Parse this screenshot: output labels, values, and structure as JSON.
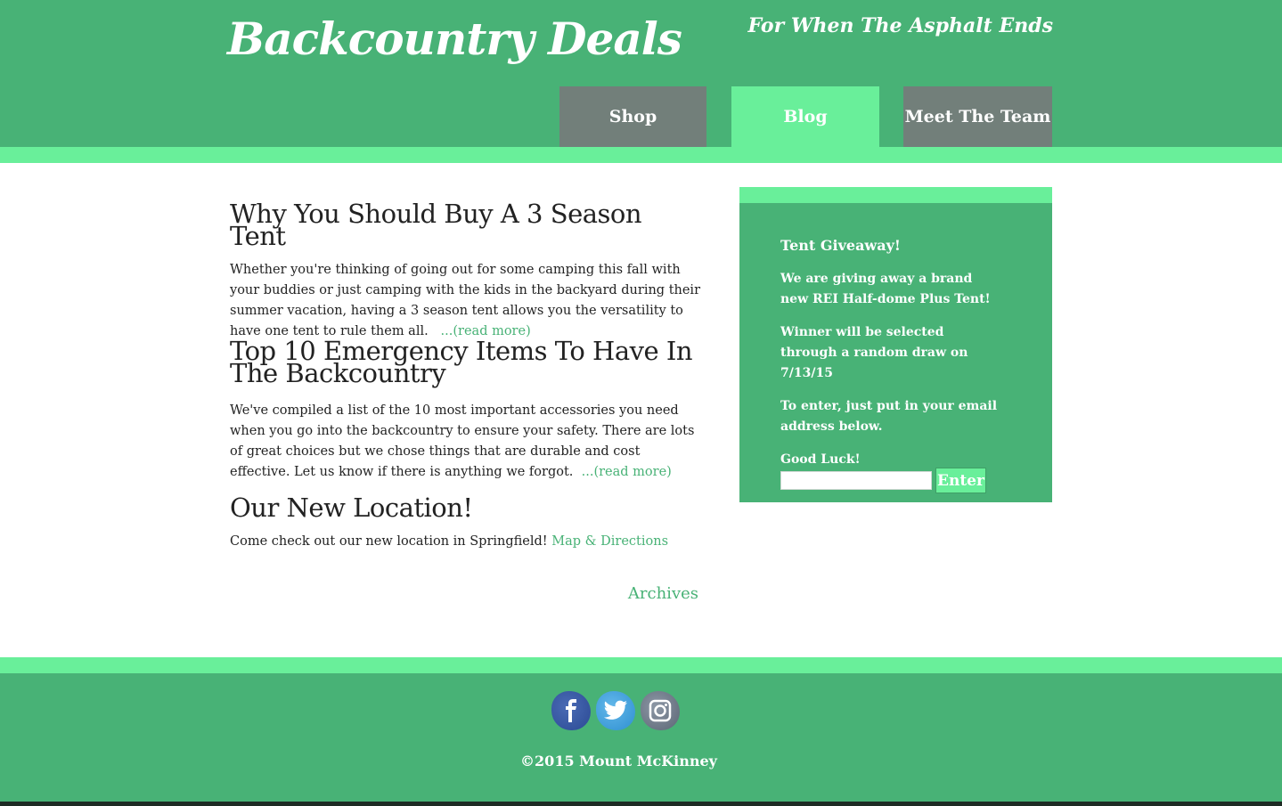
{
  "header": {
    "site_title": "Backcountry Deals",
    "tagline": "For When The Asphalt Ends",
    "nav": [
      {
        "label": "Shop",
        "active": false
      },
      {
        "label": "Blog",
        "active": true
      },
      {
        "label": "Meet The Team",
        "active": false
      }
    ]
  },
  "posts": [
    {
      "title": "Why You Should Buy A 3 Season Tent",
      "body": "Whether you're thinking of going out for some camping this fall with your buddies or just camping with the kids in the backyard during their summer vacation, having a 3 season tent allows you the versatility to have one tent to rule them all.",
      "link": "...(read more)"
    },
    {
      "title": "Top 10 Emergency Items To Have In The Backcountry",
      "body": "We've compiled a list of the 10 most important accessories you need when you go into the backcountry to ensure your safety. There are lots of great choices but we chose things that are durable and cost effective. Let us know if there is anything we forgot.",
      "link": "...(read more)"
    },
    {
      "title": "Our New Location!",
      "body": "Come check out our new location in Springfield!",
      "link": "Map & Directions"
    }
  ],
  "archives_label": "Archives",
  "sidebar": {
    "heading": "Tent Giveaway!",
    "paragraphs": [
      "We are giving away a brand new REI Half-dome Plus Tent!",
      "Winner will be selected through a random draw on 7/13/15",
      "To enter, just put in your email address below.",
      "Good Luck!"
    ],
    "email_value": "",
    "enter_label": "Enter"
  },
  "footer": {
    "social": [
      {
        "icon": "facebook-icon",
        "glyph": "f"
      },
      {
        "icon": "twitter-icon",
        "glyph": "🐦"
      },
      {
        "icon": "instagram-icon",
        "glyph": "◎"
      }
    ],
    "copyright": "©2015 Mount McKinney"
  },
  "colors": {
    "brand_green": "#48b276",
    "accent_green": "#69ef9a",
    "nav_gray": "#727f7a"
  }
}
